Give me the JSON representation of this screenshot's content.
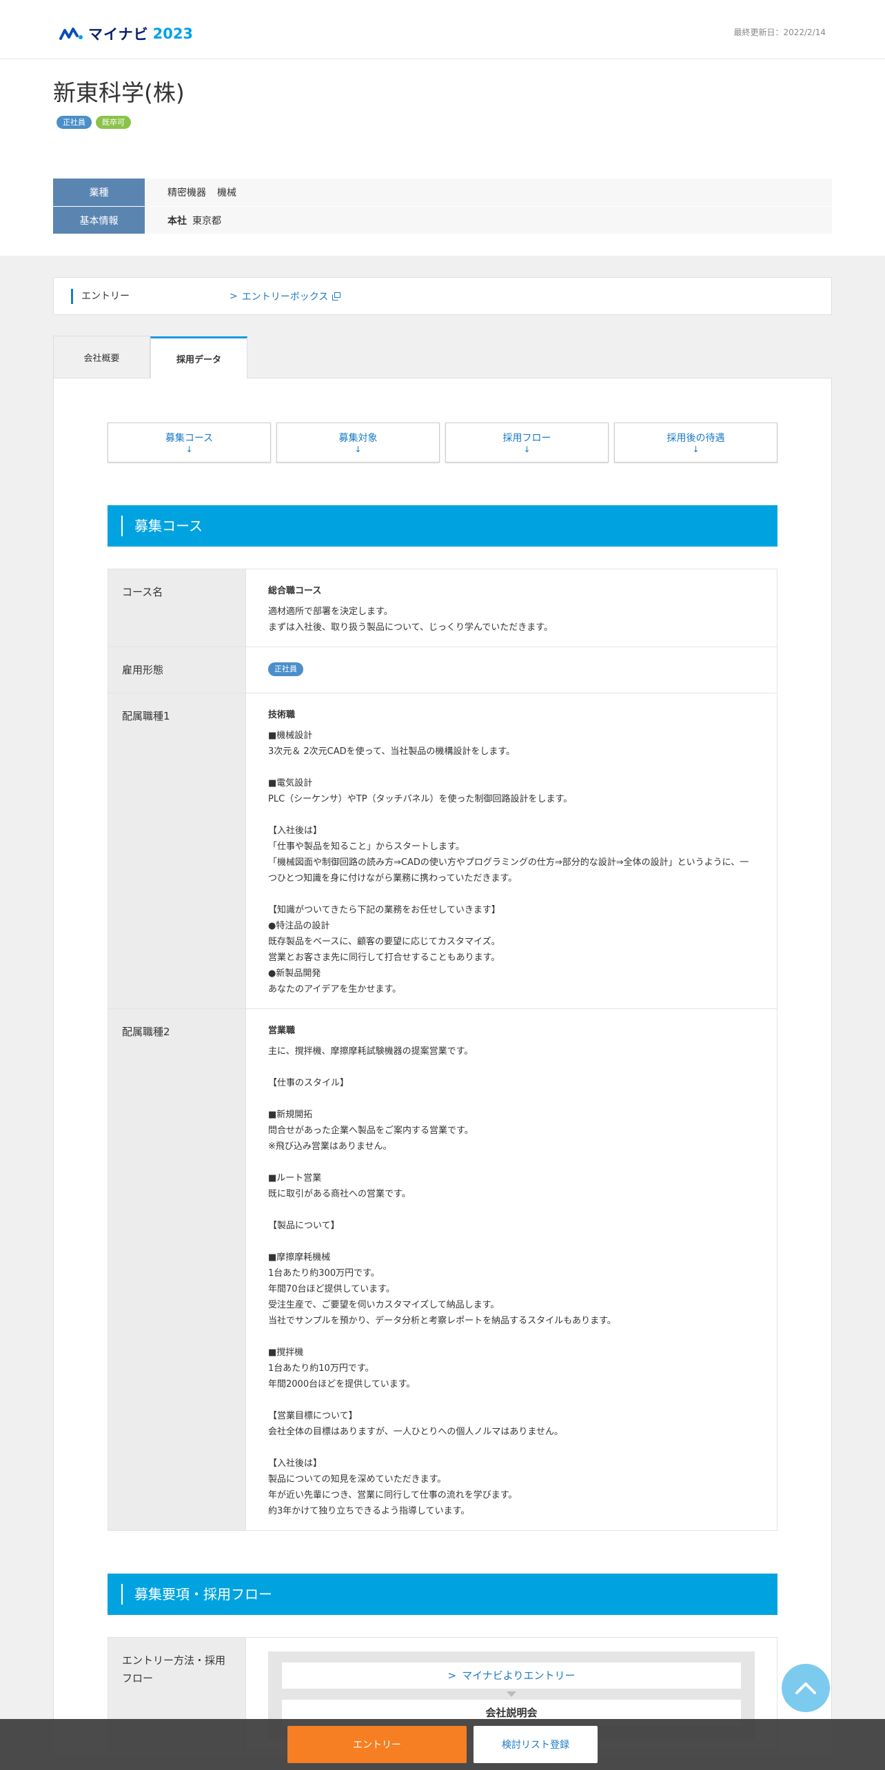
{
  "header": {
    "logo_text": "マイナビ",
    "logo_year": "2023",
    "updated": "最終更新日：2022/2/14"
  },
  "company": {
    "name": "新東科学(株)",
    "tags": [
      "正社員",
      "既卒可"
    ],
    "info": {
      "industry_label": "業種",
      "industry_values": [
        "精密機器",
        "機械"
      ],
      "basic_label": "基本情報",
      "hq_label": "本社",
      "hq_value": "東京都"
    }
  },
  "entry": {
    "title": "エントリー",
    "link": "エントリーボックス"
  },
  "tabs": [
    "会社概要",
    "採用データ"
  ],
  "jump_links": [
    "募集コース",
    "募集対象",
    "採用フロー",
    "採用後の待遇"
  ],
  "jump_arrow": "↓",
  "section1": {
    "title": "募集コース",
    "rows": [
      {
        "label": "コース名",
        "head": "総合職コース",
        "body": "適材適所で部署を決定します。\nまずは入社後、取り扱う製品について、じっくり学んでいただきます。"
      },
      {
        "label": "雇用形態",
        "badge": "正社員"
      },
      {
        "label": "配属職種1",
        "head": "技術職",
        "body": "■機械設計\n3次元＆ 2次元CADを使って、当社製品の機構設計をします。\n\n■電気設計\nPLC（シーケンサ）やTP（タッチパネル）を使った制御回路設計をします。\n\n【入社後は】\n「仕事や製品を知ること」からスタートします。\n「機械図面や制御回路の読み方⇒CADの使い方やプログラミングの仕方⇒部分的な設計⇒全体の設計」というように、一つひとつ知識を身に付けながら業務に携わっていただきます。\n\n【知識がついてきたら下記の業務をお任せしていきます】\n●特注品の設計\n既存製品をベースに、顧客の要望に応じてカスタマイズ。\n営業とお客さま先に同行して打合せすることもあります。\n●新製品開発\nあなたのアイデアを生かせます。"
      },
      {
        "label": "配属職種2",
        "head": "営業職",
        "body": "主に、撹拌機、摩擦摩耗試験機器の提案営業です。\n\n【仕事のスタイル】\n\n■新規開拓\n問合せがあった企業へ製品をご案内する営業です。\n※飛び込み営業はありません。\n\n■ルート営業\n既に取引がある商社への営業です。\n\n【製品について】\n\n■摩擦摩耗機械\n1台あたり約300万円です。\n年間70台ほど提供しています。\n受注生産で、ご要望を伺いカスタマイズして納品します。\n当社でサンプルを預かり、データ分析と考察レポートを納品するスタイルもあります。\n\n■撹拌機\n1台あたり約10万円です。\n年間2000台ほどを提供しています。\n\n【営業目標について】\n会社全体の目標はありますが、一人ひとりへの個人ノルマはありません。\n\n【入社後は】\n製品についての知見を深めていただきます。\n年が近い先輩につき、営業に同行して仕事の流れを学びます。\n約3年かけて独り立ちできるよう指導しています。"
      }
    ]
  },
  "section2": {
    "title": "募集要項・採用フロー",
    "row_label": "エントリー方法・採用フロー",
    "flow_link": "マイナビよりエントリー",
    "flow_next": "会社説明会"
  },
  "bottom": {
    "entry_button": "エントリー",
    "list_button": "検討リスト登録"
  },
  "colors": {
    "accent": "#00a3e0",
    "label_bg": "#5b85b1",
    "entry_orange": "#f57f22"
  }
}
